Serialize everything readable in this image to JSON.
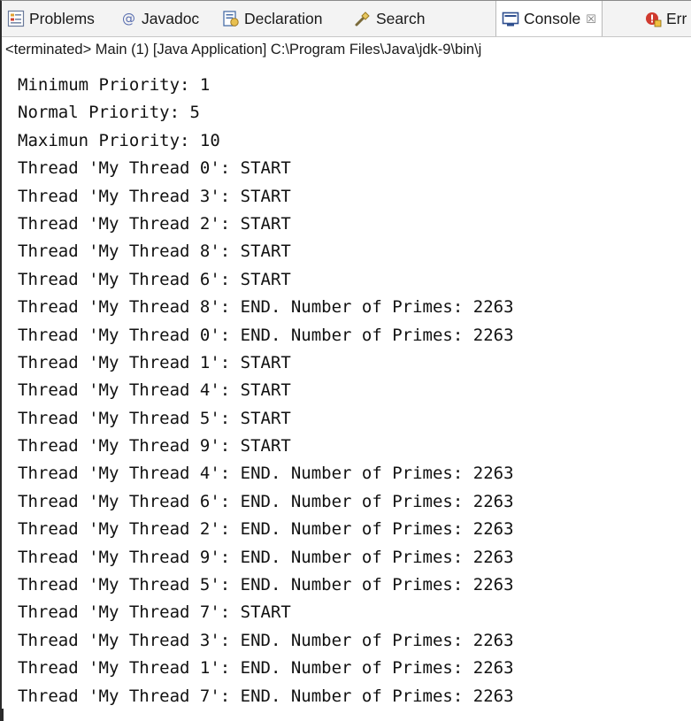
{
  "tabs": [
    {
      "label": "Problems",
      "icon": "problems-icon",
      "active": false
    },
    {
      "label": "Javadoc",
      "icon": "javadoc-at-icon",
      "active": false
    },
    {
      "label": "Declaration",
      "icon": "declaration-icon",
      "active": false
    },
    {
      "label": "Search",
      "icon": "search-flashlight-icon",
      "active": false
    },
    {
      "label": "Console",
      "icon": "console-icon",
      "active": true,
      "close": "☒"
    },
    {
      "label": "Err",
      "icon": "error-log-icon",
      "active": false
    }
  ],
  "status_line": "<terminated> Main (1) [Java Application] C:\\Program Files\\Java\\jdk-9\\bin\\j",
  "console_lines": [
    "Minimum Priority: 1",
    "Normal Priority: 5",
    "Maximun Priority: 10",
    "Thread 'My Thread 0': START",
    "Thread 'My Thread 3': START",
    "Thread 'My Thread 2': START",
    "Thread 'My Thread 8': START",
    "Thread 'My Thread 6': START",
    "Thread 'My Thread 8': END. Number of Primes: 2263",
    "Thread 'My Thread 0': END. Number of Primes: 2263",
    "Thread 'My Thread 1': START",
    "Thread 'My Thread 4': START",
    "Thread 'My Thread 5': START",
    "Thread 'My Thread 9': START",
    "Thread 'My Thread 4': END. Number of Primes: 2263",
    "Thread 'My Thread 6': END. Number of Primes: 2263",
    "Thread 'My Thread 2': END. Number of Primes: 2263",
    "Thread 'My Thread 9': END. Number of Primes: 2263",
    "Thread 'My Thread 5': END. Number of Primes: 2263",
    "Thread 'My Thread 7': START",
    "Thread 'My Thread 3': END. Number of Primes: 2263",
    "Thread 'My Thread 1': END. Number of Primes: 2263",
    "Thread 'My Thread 7': END. Number of Primes: 2263"
  ],
  "colors": {
    "tabbar_bg": "#f3f3f3",
    "console_bg": "#ffffff",
    "text": "#111111",
    "javadoc_icon": "#5a6fb0",
    "console_icon": "#2f4f8f",
    "error_icon": "#d03a2f"
  }
}
